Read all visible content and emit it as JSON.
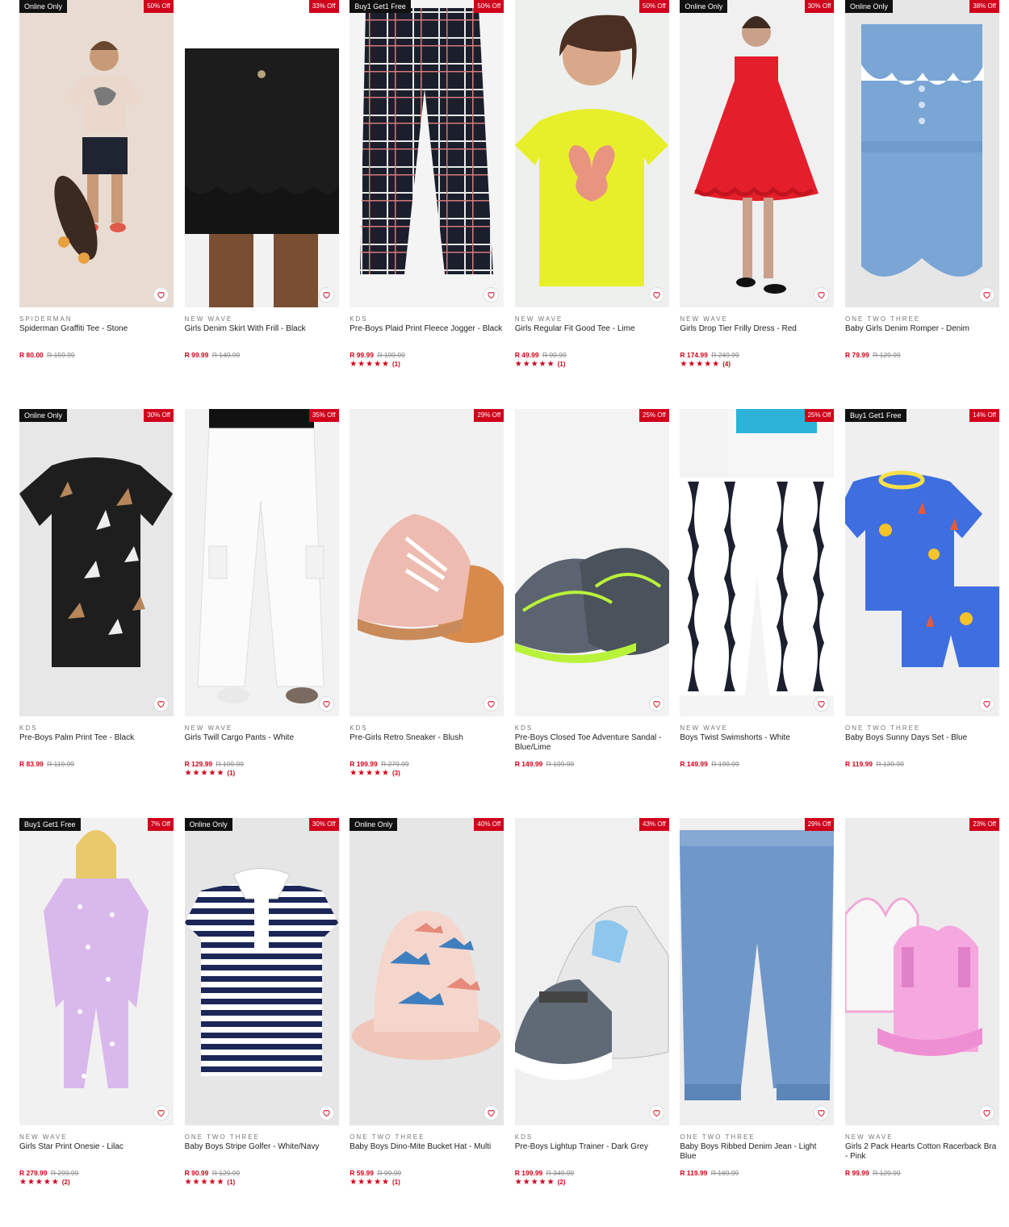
{
  "colors": {
    "accent": "#d0021b",
    "badge_dark": "#111111"
  },
  "products": [
    {
      "badge": "Online Only",
      "discount": "50% Off",
      "brand": "SPIDERMAN",
      "name": "Spiderman Graffiti Tee - Stone",
      "price": "R 80.00",
      "was": "R 159.99",
      "stars": "",
      "reviews": "",
      "bg": "#e8dcd2",
      "art": "kid-tee-stone"
    },
    {
      "badge": "",
      "discount": "33% Off",
      "brand": "NEW WAVE",
      "name": "Girls Denim Skirt With Frill - Black",
      "price": "R 99.99",
      "was": "R 149.99",
      "stars": "",
      "reviews": "",
      "bg": "#f2f2f2",
      "art": "black-skirt"
    },
    {
      "badge": "Buy1 Get1 Free",
      "discount": "50% Off",
      "brand": "KDS",
      "name": "Pre-Boys Plaid Print Fleece Jogger - Black",
      "price": "R 99.99",
      "was": "R 199.99",
      "stars": "★★★★★",
      "reviews": "(1)",
      "bg": "#f4f4f4",
      "art": "plaid-pants"
    },
    {
      "badge": "",
      "discount": "50% Off",
      "brand": "NEW WAVE",
      "name": "Girls Regular Fit Good Tee - Lime",
      "price": "R 49.99",
      "was": "R 99.99",
      "stars": "★★★★★",
      "reviews": "(1)",
      "bg": "#eef0ee",
      "art": "lime-tee"
    },
    {
      "badge": "Online Only",
      "discount": "30% Off",
      "brand": "NEW WAVE",
      "name": "Girls Drop Tier Frilly Dress - Red",
      "price": "R 174.99",
      "was": "R 249.99",
      "stars": "★★★★★",
      "reviews": "(4)",
      "bg": "#f0f0f0",
      "art": "red-dress"
    },
    {
      "badge": "Online Only",
      "discount": "38% Off",
      "brand": "ONE TWO THREE",
      "name": "Baby Girls Denim Romper - Denim",
      "price": "R 79.99",
      "was": "R 129.99",
      "stars": "",
      "reviews": "",
      "bg": "#e6e6e6",
      "art": "denim-romper"
    },
    {
      "badge": "Online Only",
      "discount": "30% Off",
      "brand": "KDS",
      "name": "Pre-Boys Palm Print Tee - Black",
      "price": "R 83.99",
      "was": "R 119.99",
      "stars": "",
      "reviews": "",
      "bg": "#e7e7e7",
      "art": "palm-tee"
    },
    {
      "badge": "",
      "discount": "35% Off",
      "brand": "NEW WAVE",
      "name": "Girls Twill Cargo Pants - White",
      "price": "R 129.99",
      "was": "R 199.99",
      "stars": "★★★★★",
      "reviews": "(1)",
      "bg": "#f2f2f2",
      "art": "white-cargo"
    },
    {
      "badge": "",
      "discount": "29% Off",
      "brand": "KDS",
      "name": "Pre-Girls Retro Sneaker - Blush",
      "price": "R 199.99",
      "was": "R 279.99",
      "stars": "★★★★★",
      "reviews": "(3)",
      "bg": "#f1f1f1",
      "art": "pink-sneaker"
    },
    {
      "badge": "",
      "discount": "25% Off",
      "brand": "KDS",
      "name": "Pre-Boys Closed Toe Adventure Sandal - Blue/Lime",
      "price": "R 149.99",
      "was": "R 199.99",
      "stars": "",
      "reviews": "",
      "bg": "#f3f3f3",
      "art": "sandal"
    },
    {
      "badge": "",
      "discount": "25% Off",
      "brand": "NEW WAVE",
      "name": "Boys Twist Swimshorts - White",
      "price": "R 149.99",
      "was": "R 199.99",
      "stars": "",
      "reviews": "",
      "bg": "#f4f4f4",
      "art": "swimshorts"
    },
    {
      "badge": "Buy1 Get1 Free",
      "discount": "14% Off",
      "brand": "ONE TWO THREE",
      "name": "Baby Boys Sunny Days Set - Blue",
      "price": "R 119.99",
      "was": "R 139.99",
      "stars": "",
      "reviews": "",
      "bg": "#efefef",
      "art": "sunny-set"
    },
    {
      "badge": "Buy1 Get1 Free",
      "discount": "7% Off",
      "brand": "NEW WAVE",
      "name": "Girls Star Print Onesie - Lilac",
      "price": "R 279.99",
      "was": "R 299.99",
      "stars": "★★★★★",
      "reviews": "(2)",
      "bg": "#f1f1f1",
      "art": "lilac-onesie"
    },
    {
      "badge": "Online Only",
      "discount": "30% Off",
      "brand": "ONE TWO THREE",
      "name": "Baby Boys Stripe Golfer - White/Navy",
      "price": "R 90.99",
      "was": "R 129.99",
      "stars": "★★★★★",
      "reviews": "(1)",
      "bg": "#e6e6e6",
      "art": "stripe-golfer"
    },
    {
      "badge": "Online Only",
      "discount": "40% Off",
      "brand": "ONE TWO THREE",
      "name": "Baby Boys Dino-Mite Bucket Hat - Multi",
      "price": "R 59.99",
      "was": "R 99.99",
      "stars": "★★★★★",
      "reviews": "(1)",
      "bg": "#e6e6e6",
      "art": "bucket-hat"
    },
    {
      "badge": "",
      "discount": "43% Off",
      "brand": "KDS",
      "name": "Pre-Boys Lightup Trainer - Dark Grey",
      "price": "R 199.99",
      "was": "R 349.99",
      "stars": "★★★★★",
      "reviews": "(2)",
      "bg": "#f0f0f0",
      "art": "trainer"
    },
    {
      "badge": "",
      "discount": "29% Off",
      "brand": "ONE TWO THREE",
      "name": "Baby Boys Ribbed Denim Jean - Light Blue",
      "price": "R 119.99",
      "was": "R 169.99",
      "stars": "",
      "reviews": "",
      "bg": "#efefef",
      "art": "denim-jean"
    },
    {
      "badge": "",
      "discount": "23% Off",
      "brand": "NEW WAVE",
      "name": "Girls 2 Pack Hearts Cotton Racerback Bra - Pink",
      "price": "R 99.99",
      "was": "R 129.99",
      "stars": "",
      "reviews": "",
      "bg": "#ececec",
      "art": "pink-bra"
    }
  ]
}
